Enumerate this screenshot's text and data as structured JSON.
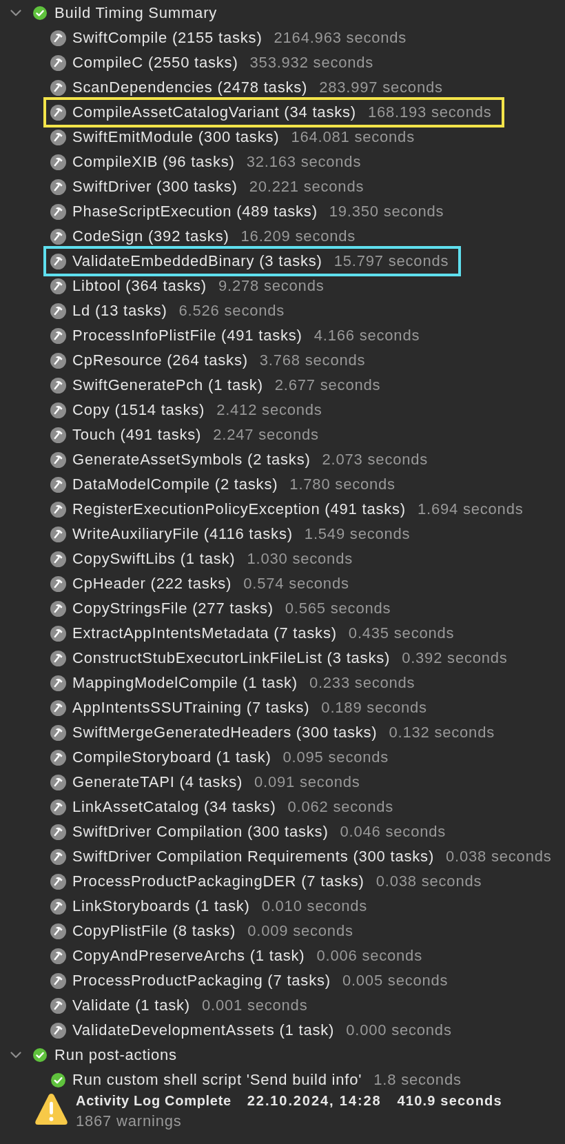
{
  "groups": [
    {
      "title": "Build Timing Summary",
      "expanded": true,
      "succeeded": true,
      "items": [
        {
          "kind": "task",
          "name": "SwiftCompile (2155 tasks)",
          "duration": "2164.963 seconds"
        },
        {
          "kind": "task",
          "name": "CompileC (2550 tasks)",
          "duration": "353.932 seconds"
        },
        {
          "kind": "task",
          "name": "ScanDependencies (2478 tasks)",
          "duration": "283.997 seconds"
        },
        {
          "kind": "task",
          "name": "CompileAssetCatalogVariant (34 tasks)",
          "duration": "168.193 seconds",
          "color": "#f3e44a"
        },
        {
          "kind": "task",
          "name": "SwiftEmitModule (300 tasks)",
          "duration": "164.081 seconds"
        },
        {
          "kind": "task",
          "name": "CompileXIB (96 tasks)",
          "duration": "32.163 seconds"
        },
        {
          "kind": "task",
          "name": "SwiftDriver (300 tasks)",
          "duration": "20.221 seconds"
        },
        {
          "kind": "task",
          "name": "PhaseScriptExecution (489 tasks)",
          "duration": "19.350 seconds"
        },
        {
          "kind": "task",
          "name": "CodeSign (392 tasks)",
          "duration": "16.209 seconds"
        },
        {
          "kind": "task",
          "name": "ValidateEmbeddedBinary (3 tasks)",
          "duration": "15.797 seconds",
          "color": "#5fdfee"
        },
        {
          "kind": "task",
          "name": "Libtool (364 tasks)",
          "duration": "9.278 seconds"
        },
        {
          "kind": "task",
          "name": "Ld (13 tasks)",
          "duration": "6.526 seconds"
        },
        {
          "kind": "task",
          "name": "ProcessInfoPlistFile (491 tasks)",
          "duration": "4.166 seconds"
        },
        {
          "kind": "task",
          "name": "CpResource (264 tasks)",
          "duration": "3.768 seconds"
        },
        {
          "kind": "task",
          "name": "SwiftGeneratePch (1 task)",
          "duration": "2.677 seconds"
        },
        {
          "kind": "task",
          "name": "Copy (1514 tasks)",
          "duration": "2.412 seconds"
        },
        {
          "kind": "task",
          "name": "Touch (491 tasks)",
          "duration": "2.247 seconds"
        },
        {
          "kind": "task",
          "name": "GenerateAssetSymbols (2 tasks)",
          "duration": "2.073 seconds"
        },
        {
          "kind": "task",
          "name": "DataModelCompile (2 tasks)",
          "duration": "1.780 seconds"
        },
        {
          "kind": "task",
          "name": "RegisterExecutionPolicyException (491 tasks)",
          "duration": "1.694 seconds"
        },
        {
          "kind": "task",
          "name": "WriteAuxiliaryFile (4116 tasks)",
          "duration": "1.549 seconds"
        },
        {
          "kind": "task",
          "name": "CopySwiftLibs (1 task)",
          "duration": "1.030 seconds"
        },
        {
          "kind": "task",
          "name": "CpHeader (222 tasks)",
          "duration": "0.574 seconds"
        },
        {
          "kind": "task",
          "name": "CopyStringsFile (277 tasks)",
          "duration": "0.565 seconds"
        },
        {
          "kind": "task",
          "name": "ExtractAppIntentsMetadata (7 tasks)",
          "duration": "0.435 seconds"
        },
        {
          "kind": "task",
          "name": "ConstructStubExecutorLinkFileList (3 tasks)",
          "duration": "0.392 seconds"
        },
        {
          "kind": "task",
          "name": "MappingModelCompile (1 task)",
          "duration": "0.233 seconds"
        },
        {
          "kind": "task",
          "name": "AppIntentsSSUTraining (7 tasks)",
          "duration": "0.189 seconds"
        },
        {
          "kind": "task",
          "name": "SwiftMergeGeneratedHeaders (300 tasks)",
          "duration": "0.132 seconds"
        },
        {
          "kind": "task",
          "name": "CompileStoryboard (1 task)",
          "duration": "0.095 seconds"
        },
        {
          "kind": "task",
          "name": "GenerateTAPI (4 tasks)",
          "duration": "0.091 seconds"
        },
        {
          "kind": "task",
          "name": "LinkAssetCatalog (34 tasks)",
          "duration": "0.062 seconds"
        },
        {
          "kind": "task",
          "name": "SwiftDriver Compilation (300 tasks)",
          "duration": "0.046 seconds"
        },
        {
          "kind": "task",
          "name": "SwiftDriver Compilation Requirements (300 tasks)",
          "duration": "0.038 seconds"
        },
        {
          "kind": "task",
          "name": "ProcessProductPackagingDER (7 tasks)",
          "duration": "0.038 seconds"
        },
        {
          "kind": "task",
          "name": "LinkStoryboards (1 task)",
          "duration": "0.010 seconds"
        },
        {
          "kind": "task",
          "name": "CopyPlistFile (8 tasks)",
          "duration": "0.009 seconds"
        },
        {
          "kind": "task",
          "name": "CopyAndPreserveArchs (1 task)",
          "duration": "0.006 seconds"
        },
        {
          "kind": "task",
          "name": "ProcessProductPackaging (7 tasks)",
          "duration": "0.005 seconds"
        },
        {
          "kind": "task",
          "name": "Validate (1 task)",
          "duration": "0.001 seconds"
        },
        {
          "kind": "task",
          "name": "ValidateDevelopmentAssets (1 task)",
          "duration": "0.000 seconds"
        }
      ]
    },
    {
      "title": "Run post-actions",
      "expanded": true,
      "succeeded": true,
      "items": [
        {
          "kind": "script",
          "name": "Run custom shell script 'Send build info'",
          "duration": "1.8 seconds"
        }
      ]
    }
  ],
  "summary": {
    "has_warnings": true,
    "title": "Activity Log Complete",
    "date": "22.10.2024, 14:28",
    "duration": "410.9 seconds",
    "warnings": "1867 warnings"
  }
}
